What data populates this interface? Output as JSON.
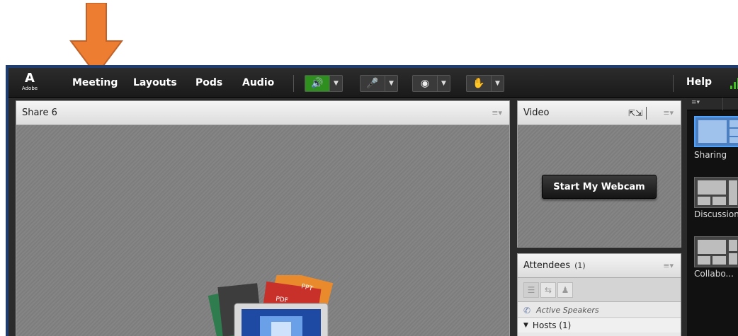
{
  "menubar": {
    "logo_word": "Adobe",
    "items": [
      {
        "label": "Meeting"
      },
      {
        "label": "Layouts"
      },
      {
        "label": "Pods"
      },
      {
        "label": "Audio"
      }
    ],
    "help_label": "Help",
    "controls": [
      {
        "icon": "speaker-icon"
      },
      {
        "icon": "microphone-icon"
      },
      {
        "icon": "webcam-icon"
      },
      {
        "icon": "raise-hand-icon"
      }
    ]
  },
  "share_pod": {
    "title": "Share 6"
  },
  "video_pod": {
    "title": "Video",
    "webcam_button": "Start My Webcam"
  },
  "attendees_pod": {
    "title": "Attendees",
    "count": "(1)",
    "active_speakers": "Active Speakers",
    "hosts": "Hosts (1)"
  },
  "layouts_panel": {
    "items": [
      {
        "label": "Sharing",
        "selected": true
      },
      {
        "label": "Discussion",
        "selected": false
      },
      {
        "label": "Collabo...",
        "selected": false
      }
    ]
  },
  "share_illustration": {
    "labels": [
      "PPT",
      "PDF"
    ]
  },
  "colors": {
    "arrow": "#ed7d31",
    "audio_active": "#2e8f1e",
    "frame": "#1f3d6e",
    "selected_layout": "#4da3ff"
  }
}
